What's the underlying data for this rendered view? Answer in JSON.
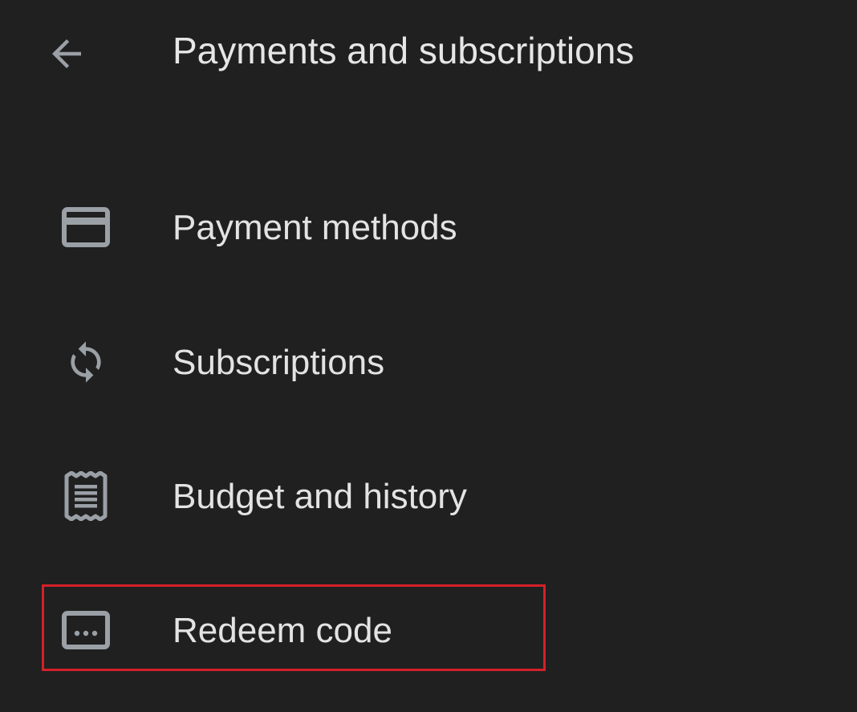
{
  "header": {
    "title": "Payments and subscriptions",
    "back_icon": "arrow-back-icon"
  },
  "menu": {
    "items": [
      {
        "label": "Payment methods",
        "icon": "credit-card-icon"
      },
      {
        "label": "Subscriptions",
        "icon": "sync-icon"
      },
      {
        "label": "Budget and history",
        "icon": "receipt-icon"
      },
      {
        "label": "Redeem code",
        "icon": "redeem-code-icon"
      }
    ]
  },
  "colors": {
    "background": "#202020",
    "text": "#e3e3e3",
    "icon": "#9aa0a6",
    "highlight": "#d4202a"
  }
}
